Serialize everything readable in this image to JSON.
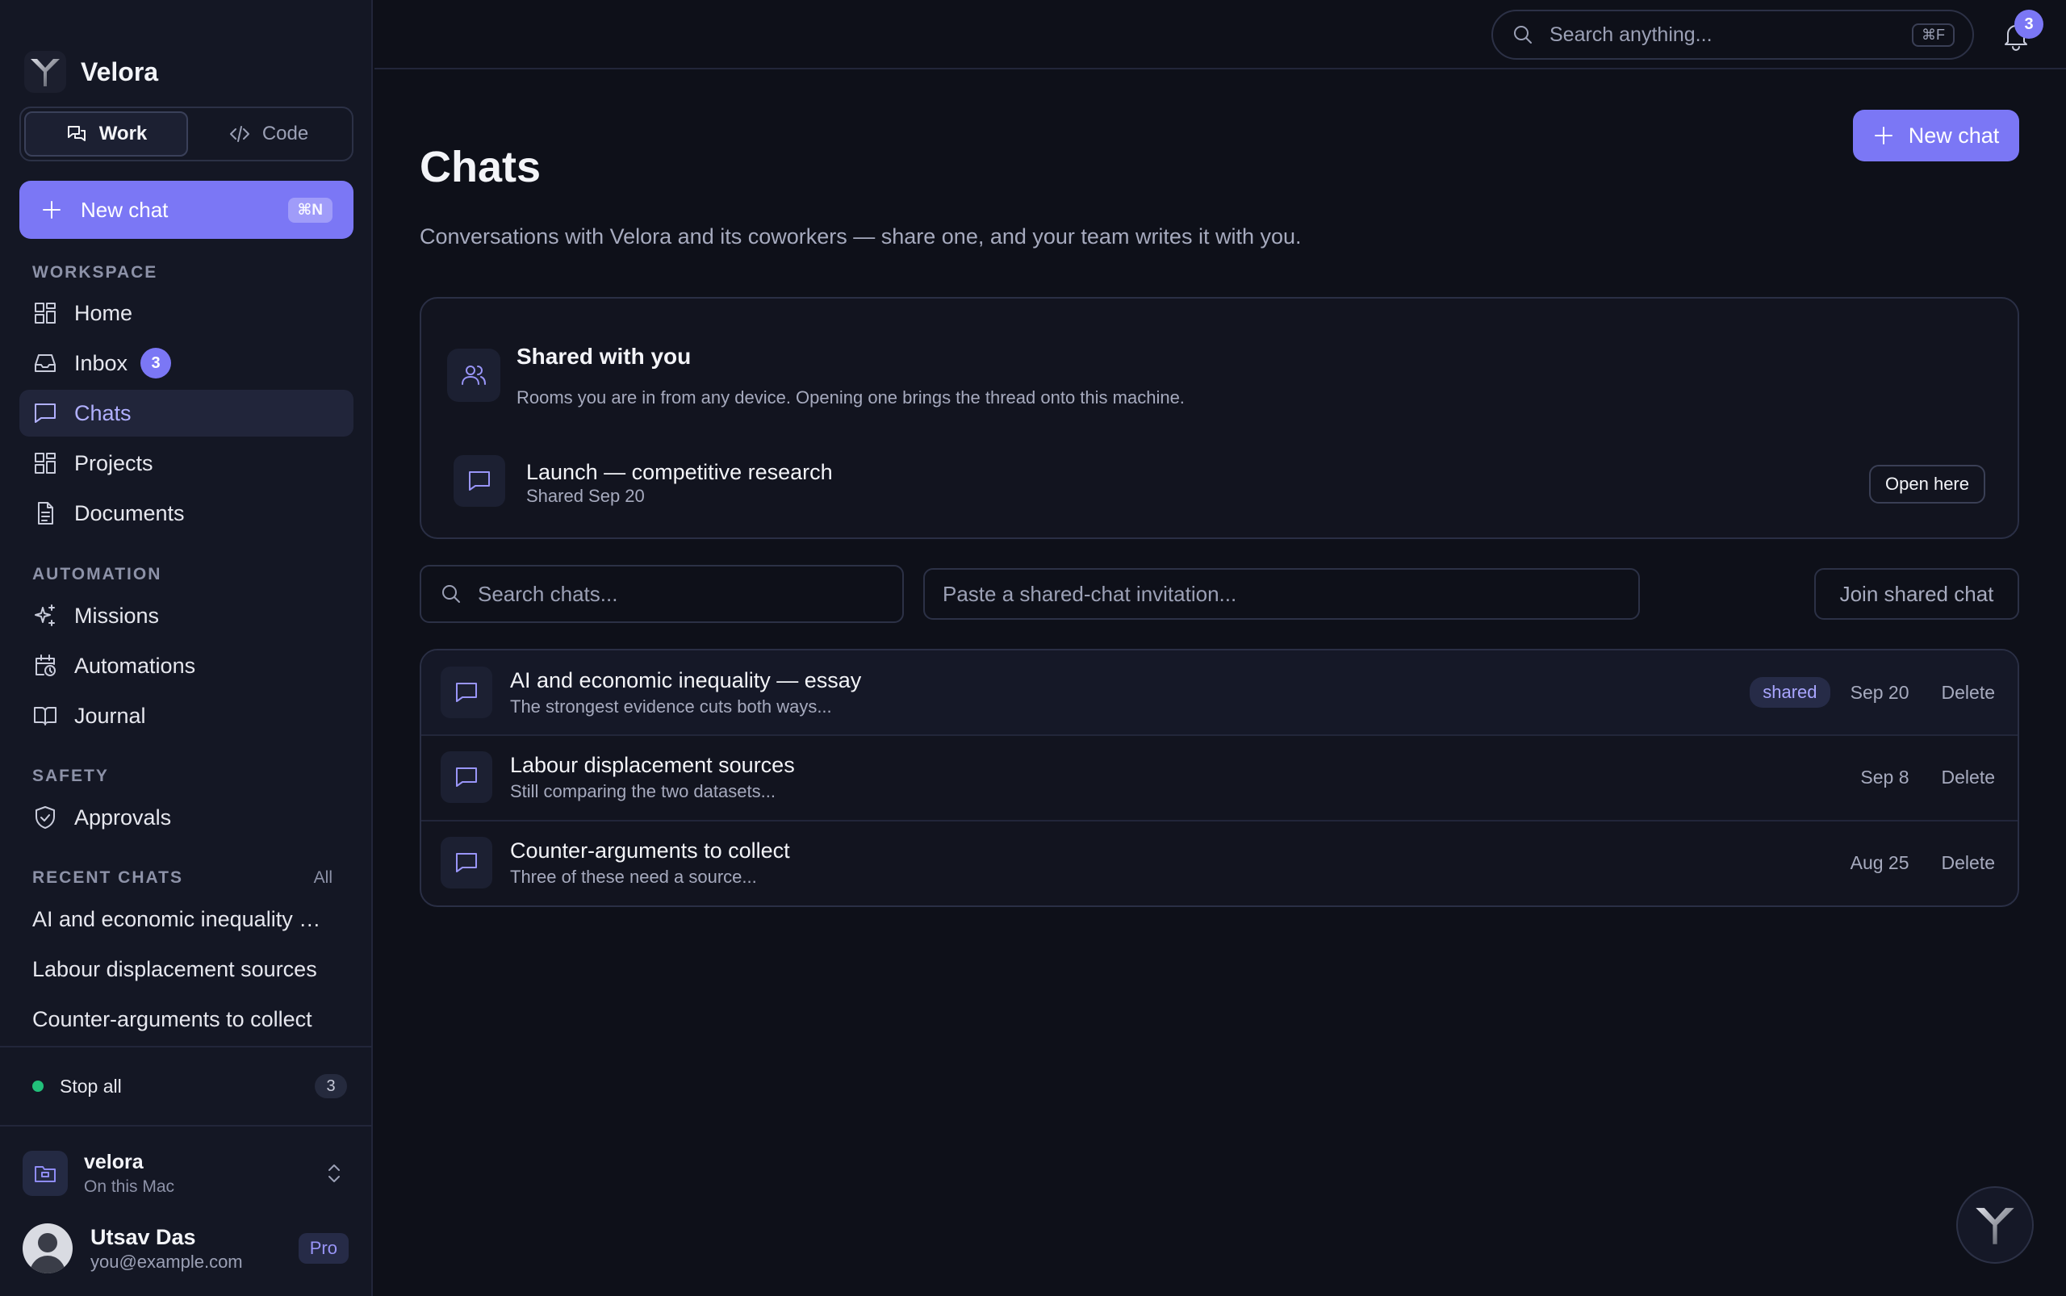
{
  "app": {
    "name": "Velora"
  },
  "sidebar": {
    "modes": [
      {
        "label": "Work"
      },
      {
        "label": "Code"
      }
    ],
    "new_chat": {
      "label": "New chat",
      "shortcut": "⌘N"
    },
    "workspace": {
      "label": "WORKSPACE",
      "items": [
        {
          "label": "Home"
        },
        {
          "label": "Inbox",
          "badge": "3"
        },
        {
          "label": "Chats"
        },
        {
          "label": "Projects"
        },
        {
          "label": "Documents"
        }
      ]
    },
    "automation": {
      "label": "AUTOMATION",
      "items": [
        {
          "label": "Missions"
        },
        {
          "label": "Automations"
        },
        {
          "label": "Journal"
        }
      ]
    },
    "safety": {
      "label": "SAFETY",
      "items": [
        {
          "label": "Approvals"
        }
      ]
    },
    "recent": {
      "label": "RECENT CHATS",
      "all_label": "All",
      "items": [
        {
          "label": "AI and economic inequality — essay"
        },
        {
          "label": "Labour displacement sources"
        },
        {
          "label": "Counter-arguments to collect"
        }
      ]
    },
    "stop_all": {
      "label": "Stop all",
      "count": "3"
    },
    "workspace_selector": {
      "name": "velora",
      "location": "On this Mac"
    },
    "user": {
      "name": "Utsav Das",
      "email": "you@example.com",
      "plan": "Pro"
    }
  },
  "topbar": {
    "search": {
      "placeholder": "Search anything...",
      "shortcut": "⌘F"
    },
    "notifications": {
      "count": "3"
    }
  },
  "main": {
    "title": "Chats",
    "subtitle": "Conversations with Velora and its coworkers — share one, and your team writes it with you.",
    "new_chat_label": "New chat",
    "shared": {
      "title": "Shared with you",
      "description": "Rooms you are in from any device. Opening one brings the thread onto this machine.",
      "items": [
        {
          "title": "Launch — competitive research",
          "subtitle": "Shared Sep 20",
          "action": "Open here"
        }
      ]
    },
    "search_chats_placeholder": "Search chats...",
    "invite_placeholder": "Paste a shared-chat invitation...",
    "join_label": "Join shared chat",
    "chats": [
      {
        "title": "AI and economic inequality — essay",
        "preview": "The strongest evidence cuts both ways...",
        "tag": "shared",
        "date": "Sep 20",
        "action": "Delete"
      },
      {
        "title": "Labour displacement sources",
        "preview": "Still comparing the two datasets...",
        "tag": "",
        "date": "Sep 8",
        "action": "Delete"
      },
      {
        "title": "Counter-arguments to collect",
        "preview": "Three of these need a source...",
        "tag": "",
        "date": "Aug 25",
        "action": "Delete"
      }
    ]
  },
  "colors": {
    "accent": "#7b77f5",
    "background": "#0e1019",
    "sidebar": "#141724",
    "status_running": "#22c07a"
  },
  "icons": {
    "brand": "velora-logo-icon",
    "work": "chat-bubbles-icon",
    "code": "code-icon",
    "home": "grid-icon",
    "inbox": "inbox-tray-icon",
    "chats": "chat-bubble-icon",
    "projects": "grid-icon",
    "documents": "document-icon",
    "missions": "sparkles-icon",
    "automations": "calendar-clock-icon",
    "journal": "book-icon",
    "approvals": "shield-check-icon"
  }
}
